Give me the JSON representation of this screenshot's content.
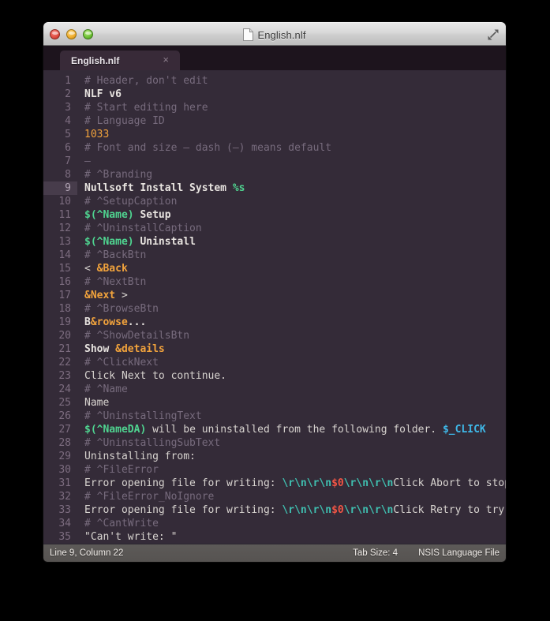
{
  "window": {
    "title": "English.nlf",
    "doc_icon": "document-icon",
    "fullscreen_icon": "fullscreen-icon",
    "traffic_lights": [
      {
        "name": "close-button",
        "color": "#e04b41"
      },
      {
        "name": "minimize-button",
        "color": "#f0ab2a"
      },
      {
        "name": "zoom-button",
        "color": "#6cc132"
      }
    ]
  },
  "tabs": [
    {
      "label": "English.nlf",
      "close_label": "×",
      "active": true
    }
  ],
  "editor": {
    "active_line": 9,
    "first_line": 1,
    "lines": [
      {
        "n": 1,
        "tokens": [
          {
            "t": "# Header, don't edit",
            "c": "c-comment"
          }
        ]
      },
      {
        "n": 2,
        "tokens": [
          {
            "t": "NLF v6",
            "c": "c-bold"
          }
        ]
      },
      {
        "n": 3,
        "tokens": [
          {
            "t": "# Start editing here",
            "c": "c-comment"
          }
        ]
      },
      {
        "n": 4,
        "tokens": [
          {
            "t": "# Language ID",
            "c": "c-comment"
          }
        ]
      },
      {
        "n": 5,
        "tokens": [
          {
            "t": "1033",
            "c": "c-number"
          }
        ]
      },
      {
        "n": 6,
        "tokens": [
          {
            "t": "# Font and size – dash (–) means default",
            "c": "c-comment"
          }
        ]
      },
      {
        "n": 7,
        "tokens": [
          {
            "t": "–",
            "c": "c-comment"
          }
        ]
      },
      {
        "n": 8,
        "tokens": [
          {
            "t": "# ^Branding",
            "c": "c-comment"
          }
        ]
      },
      {
        "n": 9,
        "tokens": [
          {
            "t": "Nullsoft Install System ",
            "c": "c-bold"
          },
          {
            "t": "%s",
            "c": "c-pct"
          }
        ]
      },
      {
        "n": 10,
        "tokens": [
          {
            "t": "# ^SetupCaption",
            "c": "c-comment"
          }
        ]
      },
      {
        "n": 11,
        "tokens": [
          {
            "t": "$(^Name)",
            "c": "c-var"
          },
          {
            "t": " Setup",
            "c": "c-bold"
          }
        ]
      },
      {
        "n": 12,
        "tokens": [
          {
            "t": "# ^UninstallCaption",
            "c": "c-comment"
          }
        ]
      },
      {
        "n": 13,
        "tokens": [
          {
            "t": "$(^Name)",
            "c": "c-var"
          },
          {
            "t": " Uninstall",
            "c": "c-bold"
          }
        ]
      },
      {
        "n": 14,
        "tokens": [
          {
            "t": "# ^BackBtn",
            "c": "c-comment"
          }
        ]
      },
      {
        "n": 15,
        "tokens": [
          {
            "t": "< ",
            "c": "c-text"
          },
          {
            "t": "&Back",
            "c": "c-accel"
          }
        ]
      },
      {
        "n": 16,
        "tokens": [
          {
            "t": "# ^NextBtn",
            "c": "c-comment"
          }
        ]
      },
      {
        "n": 17,
        "tokens": [
          {
            "t": "&Next",
            "c": "c-accel"
          },
          {
            "t": " >",
            "c": "c-text"
          }
        ]
      },
      {
        "n": 18,
        "tokens": [
          {
            "t": "# ^BrowseBtn",
            "c": "c-comment"
          }
        ]
      },
      {
        "n": 19,
        "tokens": [
          {
            "t": "B",
            "c": "c-bold"
          },
          {
            "t": "&rowse",
            "c": "c-accel"
          },
          {
            "t": "...",
            "c": "c-bold"
          }
        ]
      },
      {
        "n": 20,
        "tokens": [
          {
            "t": "# ^ShowDetailsBtn",
            "c": "c-comment"
          }
        ]
      },
      {
        "n": 21,
        "tokens": [
          {
            "t": "Show ",
            "c": "c-bold"
          },
          {
            "t": "&details",
            "c": "c-accel"
          }
        ]
      },
      {
        "n": 22,
        "tokens": [
          {
            "t": "# ^ClickNext",
            "c": "c-comment"
          }
        ]
      },
      {
        "n": 23,
        "tokens": [
          {
            "t": "Click Next to continue.",
            "c": "c-text"
          }
        ]
      },
      {
        "n": 24,
        "tokens": [
          {
            "t": "# ^Name",
            "c": "c-comment"
          }
        ]
      },
      {
        "n": 25,
        "tokens": [
          {
            "t": "Name",
            "c": "c-text"
          }
        ]
      },
      {
        "n": 26,
        "tokens": [
          {
            "t": "# ^UninstallingText",
            "c": "c-comment"
          }
        ]
      },
      {
        "n": 27,
        "tokens": [
          {
            "t": "$(^NameDA)",
            "c": "c-var"
          },
          {
            "t": " will be uninstalled from the following folder. ",
            "c": "c-text"
          },
          {
            "t": "$_CLICK",
            "c": "c-click"
          }
        ]
      },
      {
        "n": 28,
        "tokens": [
          {
            "t": "# ^UninstallingSubText",
            "c": "c-comment"
          }
        ]
      },
      {
        "n": 29,
        "tokens": [
          {
            "t": "Uninstalling from:",
            "c": "c-text"
          }
        ]
      },
      {
        "n": 30,
        "tokens": [
          {
            "t": "# ^FileError",
            "c": "c-comment"
          }
        ]
      },
      {
        "n": 31,
        "tokens": [
          {
            "t": "Error opening file for writing: ",
            "c": "c-text"
          },
          {
            "t": "\\r\\n\\r\\n",
            "c": "c-esc"
          },
          {
            "t": "$0",
            "c": "c-red"
          },
          {
            "t": "\\r\\n\\r\\n",
            "c": "c-esc"
          },
          {
            "t": "Click Abort to stop the installation,",
            "c": "c-text"
          }
        ]
      },
      {
        "n": 32,
        "tokens": [
          {
            "t": "# ^FileError_NoIgnore",
            "c": "c-comment"
          }
        ]
      },
      {
        "n": 33,
        "tokens": [
          {
            "t": "Error opening file for writing: ",
            "c": "c-text"
          },
          {
            "t": "\\r\\n\\r\\n",
            "c": "c-esc"
          },
          {
            "t": "$0",
            "c": "c-red"
          },
          {
            "t": "\\r\\n\\r\\n",
            "c": "c-esc"
          },
          {
            "t": "Click Retry to try again, or",
            "c": "c-text"
          }
        ]
      },
      {
        "n": 34,
        "tokens": [
          {
            "t": "# ^CantWrite",
            "c": "c-comment"
          }
        ]
      },
      {
        "n": 35,
        "tokens": [
          {
            "t": "\"Can't write: \"",
            "c": "c-text"
          }
        ]
      }
    ]
  },
  "statusbar": {
    "cursor": "Line 9, Column 22",
    "tab_size": "Tab Size: 4",
    "syntax": "NSIS Language File"
  }
}
